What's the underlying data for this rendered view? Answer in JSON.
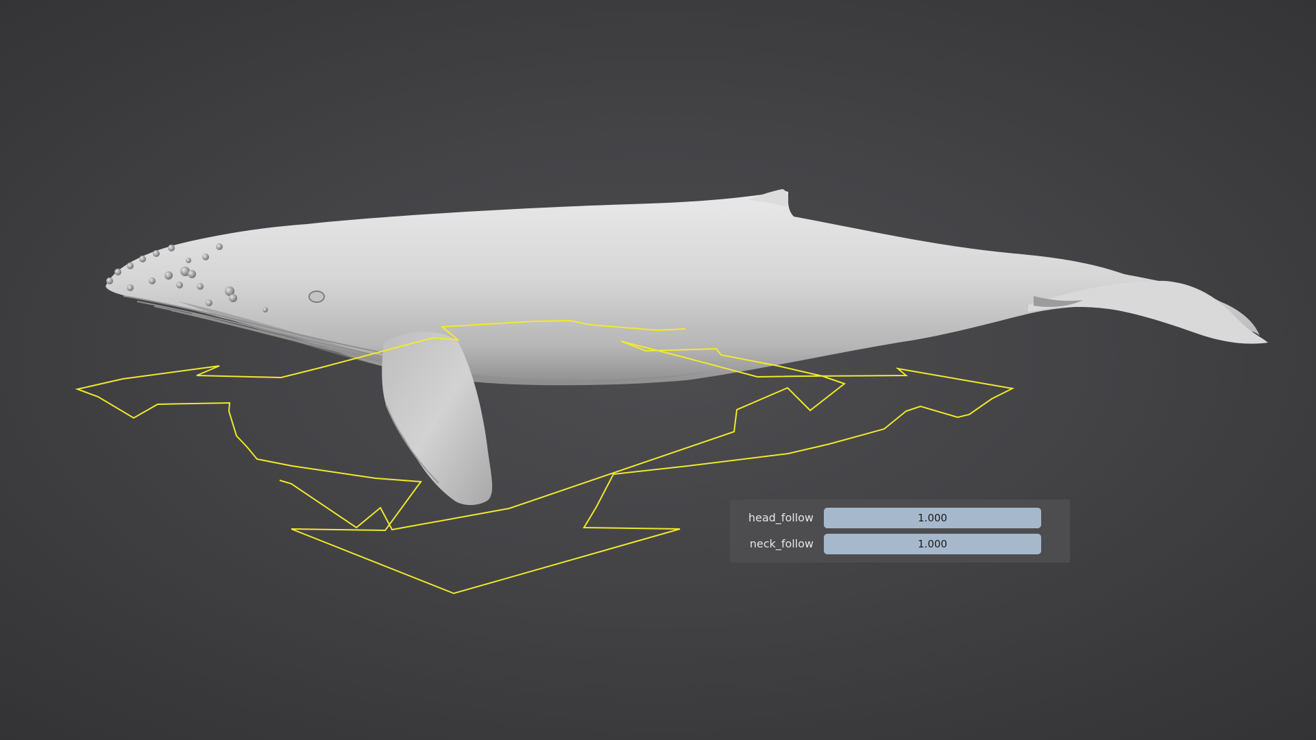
{
  "viewport": {
    "object_icon": "humpback-whale-mesh",
    "widget_icon": "move-arrows-widget",
    "widget_color": "#f2ea2a"
  },
  "properties": {
    "rows": [
      {
        "label": "head_follow",
        "value": "1.000",
        "fraction": 1.0
      },
      {
        "label": "neck_follow",
        "value": "1.000",
        "fraction": 1.0
      }
    ],
    "slider_color": "#a6b9cc"
  }
}
